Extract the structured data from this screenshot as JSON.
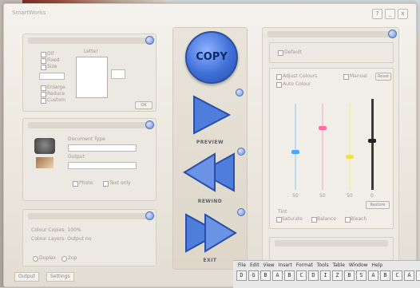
{
  "window": {
    "title": "SmartWorks"
  },
  "window_buttons": [
    "?",
    "_",
    "x"
  ],
  "center": {
    "copy_label": "COPY",
    "preview_label": "PREVIEW",
    "rewind_label": "REWIND",
    "exit_label": "EXIT"
  },
  "left_top": {
    "header": "",
    "options": [
      "Dif",
      "Fixed",
      "Size"
    ],
    "options2": [
      "Enlarge",
      "Reduce",
      "Custom"
    ],
    "preview_caption": "Letter",
    "ok_label": "OK"
  },
  "left_mid": {
    "field1_label": "Document Type",
    "field2_label": "Output",
    "chk1": "Photo",
    "chk2": "Text only"
  },
  "left_bot": {
    "line1": "Colour Copies: 100%",
    "line2": "Colour Layers: Output no",
    "radio1": "Duplex",
    "radio2": "2up"
  },
  "right": {
    "top_check": "Default",
    "section_check1": "Adjust Colours",
    "section_check2": "Auto Colour",
    "section_check3": "Manual",
    "reset_label": "Reset",
    "slider_values": [
      "50",
      "50",
      "50",
      "0"
    ],
    "bottom_checks": [
      "Saturate",
      "Balance",
      "Bleach"
    ],
    "restore_label": "Restore",
    "bottom_label": "Tint"
  },
  "tabs": [
    "Output",
    "Settings"
  ],
  "taskbar": {
    "menu": "File Edit View Insert Format Tools Table Window Help",
    "icons": [
      "D",
      "G",
      "B",
      "A",
      "B",
      "C",
      "D",
      "I",
      "Z",
      "B",
      "S",
      "A",
      "B",
      "C",
      "A",
      "B"
    ]
  },
  "colors": {
    "accent": "#3f6fd8",
    "cyan": "#4aa6ff",
    "magenta": "#ff6fa0",
    "yellow": "#f1e150",
    "black": "#222222"
  }
}
